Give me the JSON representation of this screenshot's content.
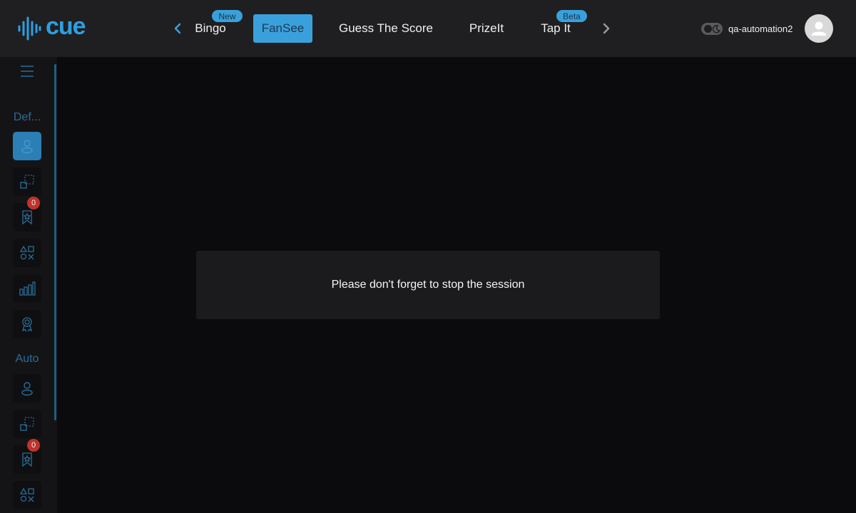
{
  "brand": {
    "name": "cue",
    "color": "#2e9fe0"
  },
  "nav": {
    "tabs": [
      {
        "label": "Bingo",
        "badge": "New",
        "active": false
      },
      {
        "label": "FanSee",
        "badge": "",
        "active": true
      },
      {
        "label": "Guess The Score",
        "badge": "",
        "active": false
      },
      {
        "label": "PrizeIt",
        "badge": "",
        "active": false
      },
      {
        "label": "Tap It",
        "badge": "Beta",
        "active": false
      }
    ],
    "prev_icon": "chevron-left-icon",
    "next_icon": "chevron-right-icon"
  },
  "user": {
    "username": "qa-automation2",
    "avatar_icon": "user-icon",
    "theme_icon": "moon-icon"
  },
  "sidebar": {
    "menu_icon": "hamburger-icon",
    "sections": [
      {
        "label": "Def...",
        "items": [
          {
            "icon": "user-icon",
            "active": true,
            "badge": ""
          },
          {
            "icon": "resize-icon",
            "active": false,
            "badge": ""
          },
          {
            "icon": "bookmark-star-icon",
            "active": false,
            "badge": "0"
          },
          {
            "icon": "shapes-icon",
            "active": false,
            "badge": ""
          },
          {
            "icon": "bar-chart-icon",
            "active": false,
            "badge": ""
          },
          {
            "icon": "award-icon",
            "active": false,
            "badge": ""
          }
        ]
      },
      {
        "label": "Auto",
        "items": [
          {
            "icon": "user-icon",
            "active": false,
            "badge": ""
          },
          {
            "icon": "resize-icon",
            "active": false,
            "badge": ""
          },
          {
            "icon": "bookmark-star-icon",
            "active": false,
            "badge": "0"
          },
          {
            "icon": "shapes-icon",
            "active": false,
            "badge": ""
          }
        ]
      }
    ]
  },
  "dialog": {
    "message": "Please don't forget to stop the session"
  },
  "colors": {
    "accent": "#3aa0db",
    "badge_red": "#c0322b",
    "topbar": "#1f1f21",
    "background": "#0b0b0d"
  }
}
